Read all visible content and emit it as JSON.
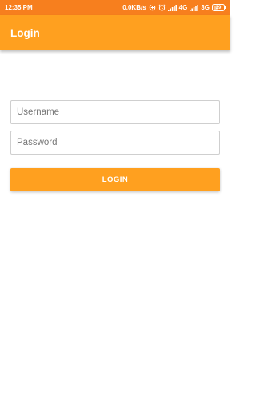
{
  "status_bar": {
    "time": "12:35 PM",
    "network_speed": "0.0KB/s",
    "sim1_type": "4G",
    "sim2_type": "3G",
    "battery": "39",
    "icons": [
      "data-saver-icon",
      "alarm-icon",
      "signal-icon",
      "signal-icon",
      "battery-icon"
    ]
  },
  "app_bar": {
    "title": "Login"
  },
  "form": {
    "username_placeholder": "Username",
    "username_value": "",
    "password_placeholder": "Password",
    "password_value": "",
    "login_label": "LOGIN"
  },
  "colors": {
    "status_bar": "#F77F1E",
    "accent": "#FFA01F",
    "background": "#FFFFFF",
    "field_border": "#CFCFCF"
  }
}
